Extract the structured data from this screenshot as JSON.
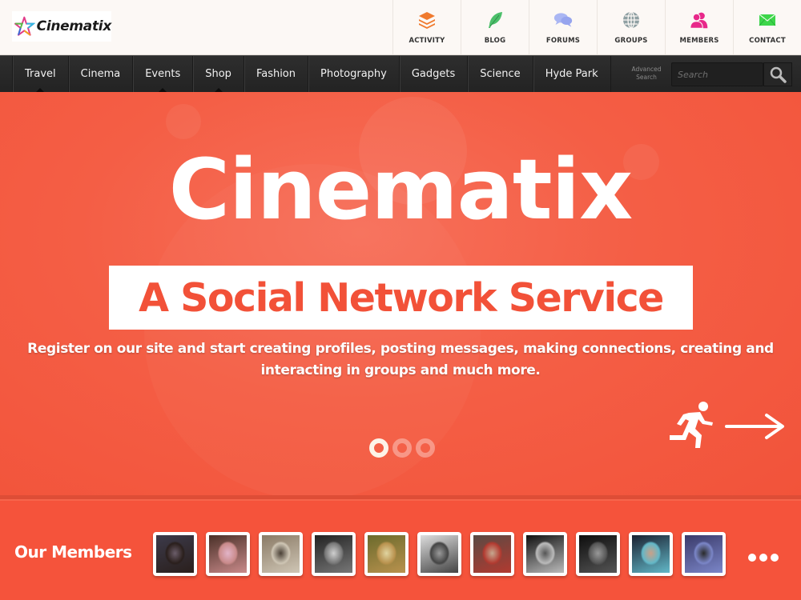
{
  "brand": {
    "name": "Cinematix"
  },
  "topnav": {
    "items": [
      {
        "label": "ACTIVITY",
        "icon": "layers-icon",
        "color": "#f07a2e"
      },
      {
        "label": "BLOG",
        "icon": "feather-icon",
        "color": "#4cbf6a"
      },
      {
        "label": "FORUMS",
        "icon": "chat-bubbles-icon",
        "color": "#a9b6f2"
      },
      {
        "label": "GROUPS",
        "icon": "globe-icon",
        "color": "#8fa0a3"
      },
      {
        "label": "MEMBERS",
        "icon": "users-icon",
        "color": "#e8288a"
      },
      {
        "label": "CONTACT",
        "icon": "envelope-icon",
        "color": "#3dd64a"
      }
    ]
  },
  "menu": {
    "items": [
      {
        "label": "Travel",
        "has_submenu": true
      },
      {
        "label": "Cinema",
        "has_submenu": false
      },
      {
        "label": "Events",
        "has_submenu": true
      },
      {
        "label": "Shop",
        "has_submenu": true
      },
      {
        "label": "Fashion",
        "has_submenu": false
      },
      {
        "label": "Photography",
        "has_submenu": false
      },
      {
        "label": "Gadgets",
        "has_submenu": false
      },
      {
        "label": "Science",
        "has_submenu": false
      },
      {
        "label": "Hyde Park",
        "has_submenu": false
      }
    ],
    "advanced_search_line1": "Advanced",
    "advanced_search_line2": "Search",
    "search_placeholder": "Search",
    "search_value": ""
  },
  "hero": {
    "title": "Cinematix",
    "subtitle": "A Social Network Service",
    "description": "Register on our site and start creating profiles, posting messages, making connections, creating and interacting in groups and much more.",
    "slides_total": 3,
    "active_slide": 1,
    "next_icon": "running-man-icon",
    "arrow_icon": "arrow-right-icon",
    "accent_color": "#f5533b"
  },
  "members": {
    "title": "Our Members",
    "avatars": [
      {
        "tones": [
          "#3c3a4a",
          "#2a1f1c",
          "#6b5d6a"
        ]
      },
      {
        "tones": [
          "#4a3028",
          "#c98a8a",
          "#e2b4c8"
        ]
      },
      {
        "tones": [
          "#8a7a66",
          "#cfc6b5",
          "#4a4036"
        ]
      },
      {
        "tones": [
          "#222",
          "#777",
          "#cfcfcf"
        ]
      },
      {
        "tones": [
          "#6b6a2c",
          "#b9924e",
          "#e0d4a0"
        ]
      },
      {
        "tones": [
          "#ddd",
          "#444",
          "#9a9a9a"
        ]
      },
      {
        "tones": [
          "#5a4a44",
          "#b23a30",
          "#c6a890"
        ]
      },
      {
        "tones": [
          "#111",
          "#bbb",
          "#555"
        ]
      },
      {
        "tones": [
          "#0d0d0d",
          "#555",
          "#999"
        ]
      },
      {
        "tones": [
          "#1a2030",
          "#62b8c8",
          "#caa088"
        ]
      },
      {
        "tones": [
          "#3a3a6a",
          "#7b86c8",
          "#2a2a2a"
        ]
      }
    ],
    "more_icon": "more-dots-icon"
  }
}
